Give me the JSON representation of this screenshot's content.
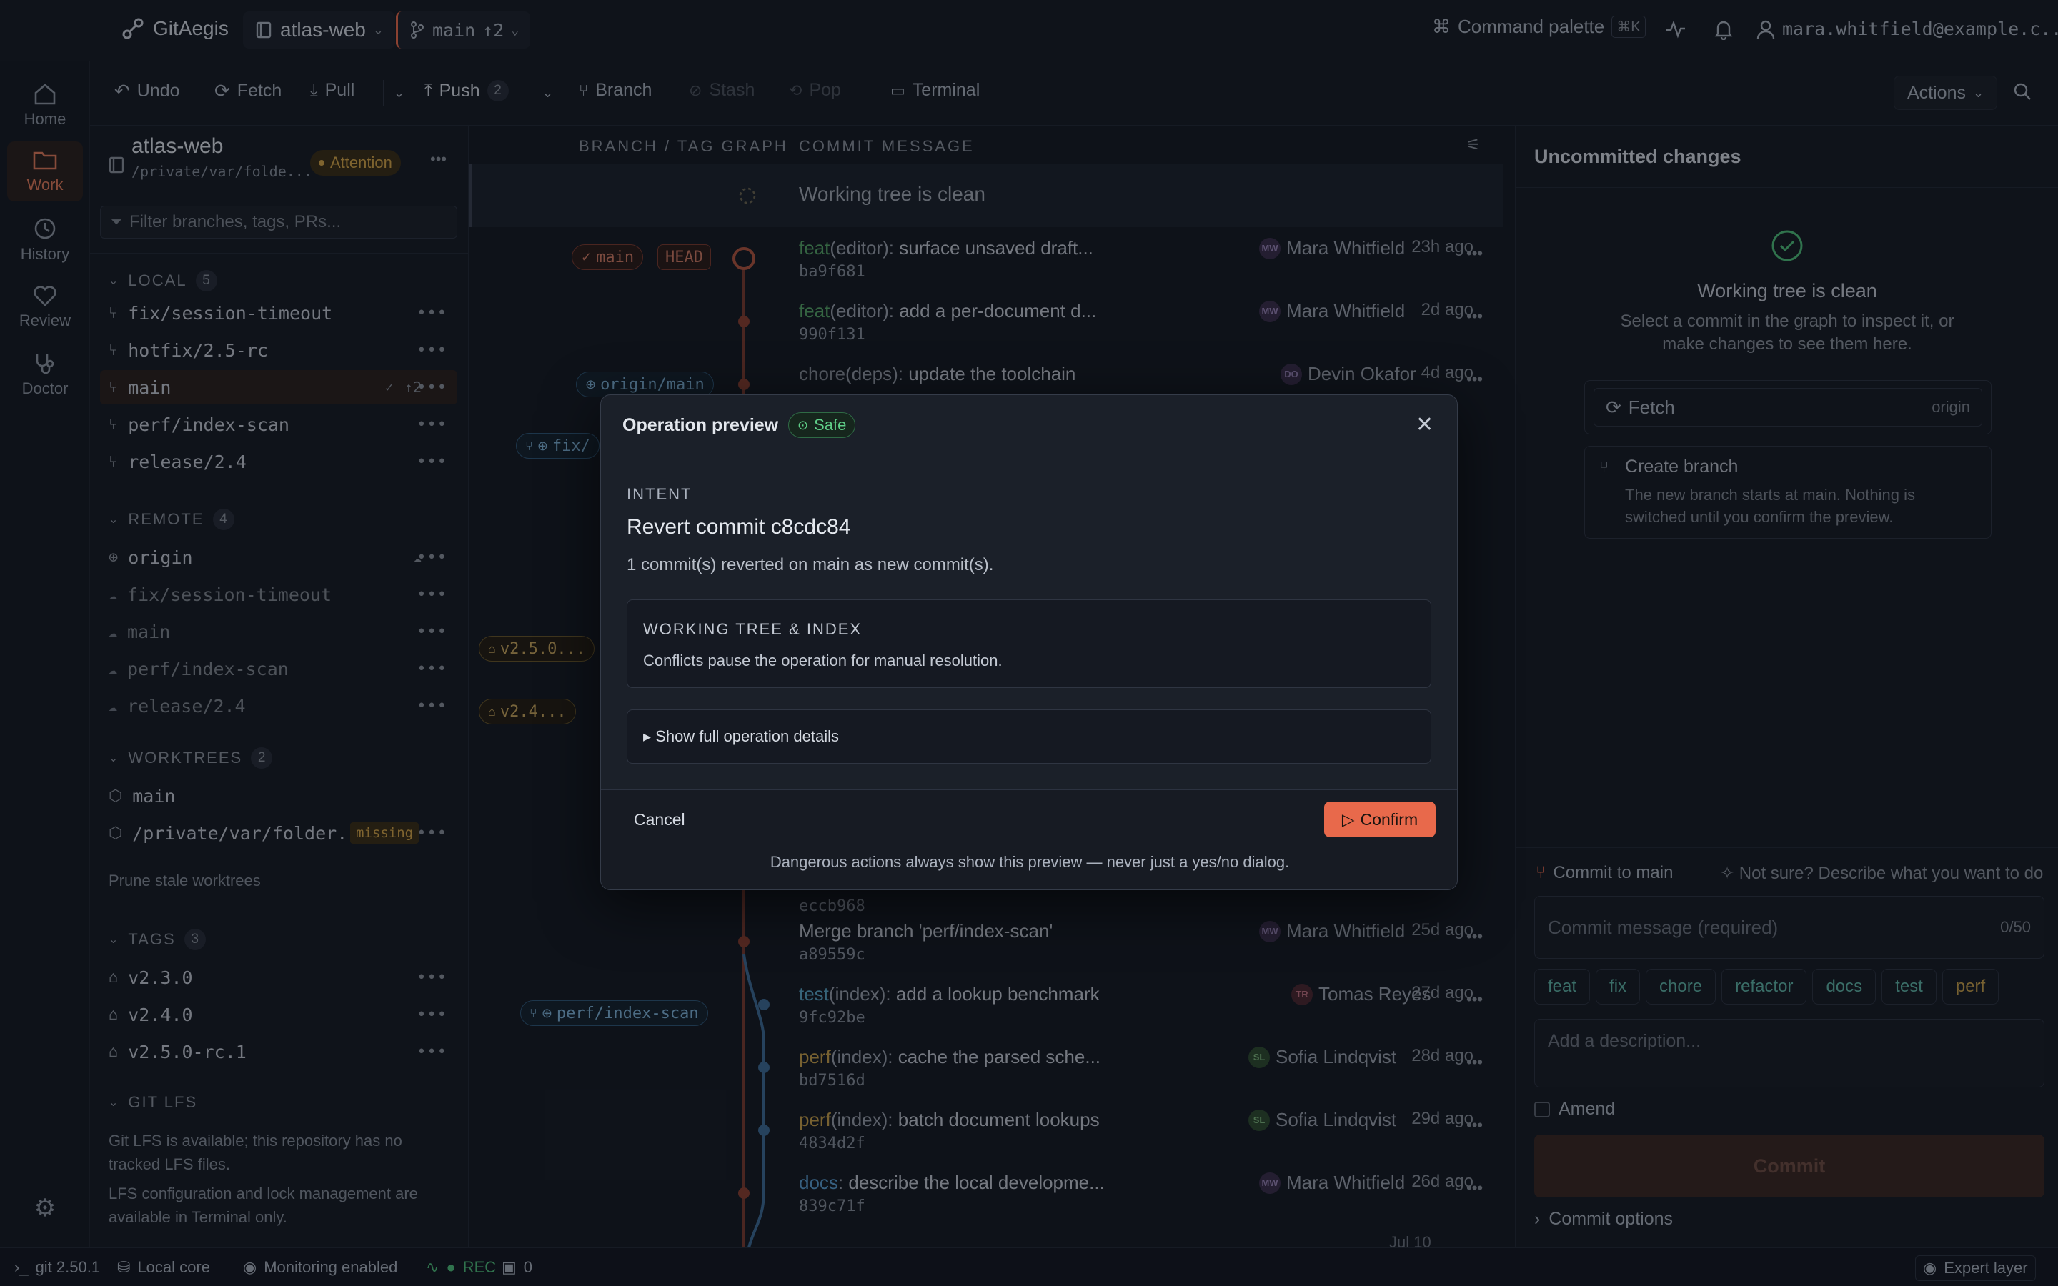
{
  "app": {
    "name": "GitAegis",
    "repo": "atlas-web",
    "branch": "main",
    "branch_ahead": "↑2",
    "command_palette": "Command palette",
    "shortcut": "⌘K",
    "user": "mara.whitfield@example.c..."
  },
  "toolbar": {
    "undo": "Undo",
    "fetch": "Fetch",
    "pull": "Pull",
    "push": "Push",
    "push_count": "2",
    "branch": "Branch",
    "stash": "Stash",
    "pop": "Pop",
    "terminal": "Terminal",
    "actions": "Actions"
  },
  "rail": [
    {
      "label": "Home",
      "icon": "home-icon"
    },
    {
      "label": "Work",
      "icon": "folder-icon"
    },
    {
      "label": "History",
      "icon": "history-icon"
    },
    {
      "label": "Review",
      "icon": "heart-icon"
    },
    {
      "label": "Doctor",
      "icon": "stethoscope-icon"
    }
  ],
  "sidebar": {
    "repo_name": "atlas-web",
    "repo_path": "/private/var/folde...",
    "attention": "Attention",
    "filter_placeholder": "Filter branches, tags, PRs...",
    "local_label": "LOCAL",
    "local_count": "5",
    "local": [
      "fix/session-timeout",
      "hotfix/2.5-rc",
      "main",
      "perf/index-scan",
      "release/2.4"
    ],
    "main_ahead": "↑2",
    "remote_label": "REMOTE",
    "remote_count": "4",
    "remote_origin": "origin",
    "remote": [
      "fix/session-timeout",
      "main",
      "perf/index-scan",
      "release/2.4"
    ],
    "worktrees_label": "WORKTREES",
    "worktrees_count": "2",
    "worktrees": [
      "main",
      "/private/var/folder..."
    ],
    "missing": "missing",
    "prune": "Prune stale worktrees",
    "tags_label": "TAGS",
    "tags_count": "3",
    "tags": [
      "v2.3.0",
      "v2.4.0",
      "v2.5.0-rc.1"
    ],
    "lfs_label": "GIT LFS",
    "lfs_text1": "Git LFS is available; this repository has no tracked LFS files.",
    "lfs_text2": "LFS configuration and lock management are available in Terminal only."
  },
  "graph": {
    "col_graph": "BRANCH / TAG GRAPH",
    "col_message": "COMMIT MESSAGE",
    "clean": "Working tree is clean",
    "refs": {
      "main": "main",
      "head": "HEAD",
      "origin_main": "origin/main",
      "fix": "fix/",
      "v250": "v2.5.0...",
      "v24": "v2.4...",
      "perf": "perf/index-scan"
    },
    "commits_top": [
      {
        "type": "feat",
        "scope": "(editor): ",
        "msg": "surface unsaved draft...",
        "hash": "ba9f681",
        "author": "Mara Whitfield",
        "initials": "MW",
        "time": "23h ago"
      },
      {
        "type": "feat",
        "scope": "(editor): ",
        "msg": "add a per-document d...",
        "hash": "990f131",
        "author": "Mara Whitfield",
        "initials": "MW",
        "time": "2d ago"
      },
      {
        "type": "chore",
        "scope": "(deps): ",
        "msg": "update the toolchain",
        "hash": "",
        "author": "Devin Okafor",
        "initials": "DO",
        "time": "4d ago"
      }
    ],
    "partial_hash": "eccb968",
    "commits_bottom": [
      {
        "type": "",
        "scope": "",
        "msg": "Merge branch 'perf/index-scan'",
        "hash": "a89559c",
        "author": "Mara Whitfield",
        "initials": "MW",
        "time": "25d ago"
      },
      {
        "type": "test",
        "scope": "(index): ",
        "msg": "add a lookup benchmark",
        "hash": "9fc92be",
        "author": "Tomas Reyes",
        "initials": "TR",
        "time": "27d ago"
      },
      {
        "type": "perf",
        "scope": "(index): ",
        "msg": "cache the parsed sche...",
        "hash": "bd7516d",
        "author": "Sofia Lindqvist",
        "initials": "SL",
        "time": "28d ago"
      },
      {
        "type": "perf",
        "scope": "(index): ",
        "msg": "batch document lookups",
        "hash": "4834d2f",
        "author": "Sofia Lindqvist",
        "initials": "SL",
        "time": "29d ago"
      },
      {
        "type": "docs",
        "scope": ": ",
        "msg": "describe the local developme...",
        "hash": "839c71f",
        "author": "Mara Whitfield",
        "initials": "MW",
        "time": "26d ago"
      }
    ],
    "last_time": "Jul 10"
  },
  "right": {
    "title": "Uncommitted changes",
    "clean_title": "Working tree is clean",
    "clean_desc": "Select a commit in the graph to inspect it, or make changes to see them here.",
    "fetch": "Fetch",
    "origin": "origin",
    "create_branch": "Create branch",
    "create_desc": "The new branch starts at main. Nothing is switched until you confirm the preview.",
    "commit_to": "Commit to main",
    "not_sure": "Not sure? Describe what you want to do",
    "message_placeholder": "Commit message (required)",
    "counter": "0/50",
    "chips": [
      "feat",
      "fix",
      "chore",
      "refactor",
      "docs",
      "test",
      "perf"
    ],
    "desc_placeholder": "Add a description...",
    "amend": "Amend",
    "commit": "Commit",
    "commit_options": "Commit options"
  },
  "status": {
    "git": "git 2.50.1",
    "core": "Local core",
    "monitoring": "Monitoring enabled",
    "rec": "REC",
    "count": "0",
    "expert": "Expert layer"
  },
  "modal": {
    "title": "Operation preview",
    "badge": "Safe",
    "intent_label": "INTENT",
    "heading": "Revert commit c8cdc84",
    "subtext": "1 commit(s) reverted on main as new commit(s).",
    "box_title": "WORKING TREE & INDEX",
    "box_text": "Conflicts pause the operation for manual resolution.",
    "details": "▸ Show full operation details",
    "cancel": "Cancel",
    "confirm": "Confirm",
    "footer": "Dangerous actions always show this preview — never just a yes/no dialog."
  },
  "colors": {
    "accent": "#e8694b",
    "feat": "#57a868",
    "chore": "#8a919c",
    "perf": "#c9a14a",
    "test": "#5aa7c8",
    "docs": "#5a9fd4",
    "safe": "#4fbf7a"
  }
}
